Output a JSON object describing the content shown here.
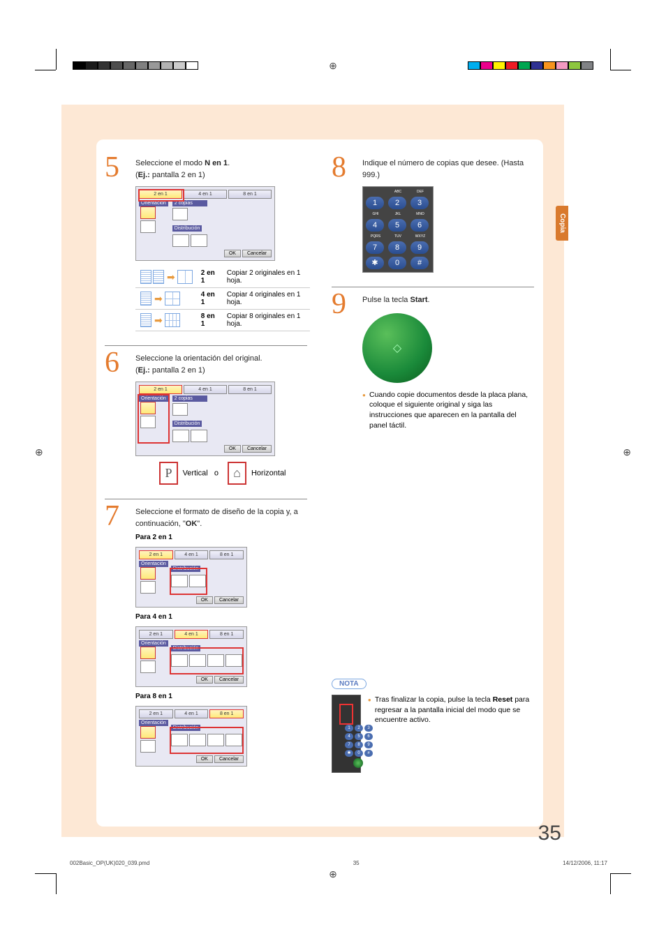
{
  "side_tab": "Copia",
  "steps": {
    "s5": {
      "num": "5",
      "text_pre": "Seleccione el modo ",
      "text_bold": "N en 1",
      "text_post": ".",
      "eg_label": "Ej.:",
      "eg_value": " pantalla 2 en 1)",
      "modes": [
        "2 en 1",
        "4 en 1",
        "8 en 1"
      ],
      "orient_label": "Orientación",
      "copias_label": "2 copias",
      "distrib_label": "Distribución",
      "ok": "OK",
      "cancel": "Cancelar",
      "rows": [
        {
          "mode": "2 en 1",
          "desc": "Copiar 2 originales en 1 hoja."
        },
        {
          "mode": "4 en 1",
          "desc": "Copiar 4 originales en 1 hoja."
        },
        {
          "mode": "8 en 1",
          "desc": "Copiar 8 originales en 1 hoja."
        }
      ]
    },
    "s6": {
      "num": "6",
      "text": "Seleccione la orientación del original.",
      "eg_label": "Ej.:",
      "eg_value": " pantalla 2 en 1)",
      "vertical": "Vertical",
      "or": "o",
      "horizontal": "Horizontal"
    },
    "s7": {
      "num": "7",
      "text_pre": "Seleccione el formato de diseño de la copia y, a continuación, \"",
      "text_bold": "OK",
      "text_post": "\".",
      "heads": [
        "Para 2 en 1",
        "Para 4 en 1",
        "Para 8 en 1"
      ]
    },
    "s8": {
      "num": "8",
      "text": "Indique el número de copias que desee. (Hasta 999.)",
      "keypad_labels": [
        "",
        "ABC",
        "DEF",
        "GHI",
        "JKL",
        "MNO",
        "PQRS",
        "TUV",
        "WXYZ"
      ],
      "keys": [
        "1",
        "2",
        "3",
        "4",
        "5",
        "6",
        "7",
        "8",
        "9",
        "✱",
        "0",
        "#"
      ]
    },
    "s9": {
      "num": "9",
      "text_pre": "Pulse la tecla ",
      "text_bold": "Start",
      "text_post": ".",
      "bullet": "Cuando copie documentos desde la placa plana, coloque el siguiente original y siga las instrucciones que aparecen en la pantalla del panel táctil."
    }
  },
  "nota": {
    "label": "NOTA",
    "keys": [
      "1",
      "2",
      "3",
      "4",
      "5",
      "6",
      "7",
      "8",
      "9",
      "✱",
      "0",
      "#"
    ],
    "text_pre": "Tras finalizar la copia, pulse la tecla ",
    "text_bold": "Reset",
    "text_post": " para regresar a la pantalla inicial del modo que se encuentre activo."
  },
  "page_number": "35",
  "footer": {
    "file": "002Basic_OP(UK)020_039.pmd",
    "page": "35",
    "date": "14/12/2006, 11:17"
  },
  "colors_left": [
    "#000",
    "#1a1a1a",
    "#333",
    "#4d4d4d",
    "#666",
    "#808080",
    "#999",
    "#b3b3b3",
    "#ccc",
    "#fff"
  ],
  "colors_right": [
    "#00aeef",
    "#ec008c",
    "#fff200",
    "#ed1c24",
    "#00a651",
    "#2e3192",
    "#f7941d",
    "#f49ac1",
    "#8dc63f",
    "#808285"
  ]
}
